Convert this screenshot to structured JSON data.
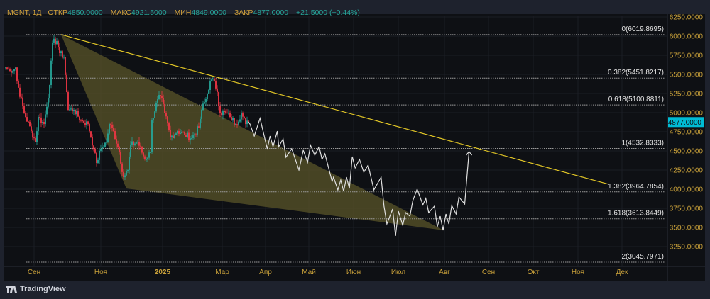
{
  "legend": {
    "symbol": "MGNT, 1Д",
    "open_label": "ОТКР",
    "open": "4850.0000",
    "high_label": "МАКС",
    "high": "4921.5000",
    "low_label": "МИН",
    "low": "4849.0000",
    "close_label": "ЗАКР",
    "close": "4877.0000",
    "change": "+21.5000 (+0.44%)"
  },
  "branding": {
    "name": "TradingView"
  },
  "colors": {
    "up": "#26a69a",
    "down": "#f23645",
    "trend": "#e3c726",
    "fill": "#5a5428",
    "projection": "#e0e0e0",
    "axis_text": "#c9a13a",
    "price_badge": "#00bcd4"
  },
  "chart_data": {
    "type": "candlestick",
    "symbol": "MGNT",
    "interval": "1D",
    "ylim": [
      3050,
      6300
    ],
    "y_ticks": [
      "6250.0000",
      "6000.0000",
      "5750.0000",
      "5500.0000",
      "5250.0000",
      "5000.0000",
      "4750.0000",
      "4500.0000",
      "4250.0000",
      "4000.0000",
      "3750.0000",
      "3500.0000",
      "3250.0000"
    ],
    "y_tick_values": [
      6250,
      6000,
      5750,
      5500,
      5250,
      5000,
      4750,
      4500,
      4250,
      4000,
      3750,
      3500,
      3250
    ],
    "x_ticks": [
      "Сен",
      "Ноя",
      "2025",
      "Мар",
      "Апр",
      "Май",
      "Июн",
      "Июл",
      "Авг",
      "Сен",
      "Окт",
      "Ноя",
      "Дек"
    ],
    "last_price": "4877.0000",
    "last_price_value": 4877,
    "close_waypoints": [
      [
        0,
        5590
      ],
      [
        3,
        5546
      ],
      [
        7,
        5590
      ],
      [
        8,
        5407
      ],
      [
        13,
        5000
      ],
      [
        18,
        4759
      ],
      [
        21,
        4620
      ],
      [
        23,
        4944
      ],
      [
        27,
        4851
      ],
      [
        31,
        5361
      ],
      [
        33,
        5917
      ],
      [
        36,
        5935
      ],
      [
        38,
        5778
      ],
      [
        41,
        5731
      ],
      [
        43,
        5268
      ],
      [
        44,
        5037
      ],
      [
        48,
        5037
      ],
      [
        53,
        4898
      ],
      [
        58,
        4851
      ],
      [
        62,
        4528
      ],
      [
        64,
        4343
      ],
      [
        67,
        4528
      ],
      [
        71,
        4620
      ],
      [
        73,
        4851
      ],
      [
        76,
        4759
      ],
      [
        80,
        4481
      ],
      [
        83,
        4157
      ],
      [
        86,
        4250
      ],
      [
        88,
        4574
      ],
      [
        93,
        4620
      ],
      [
        98,
        4389
      ],
      [
        102,
        4481
      ],
      [
        103,
        4898
      ],
      [
        107,
        5176
      ],
      [
        109,
        5222
      ],
      [
        112,
        5000
      ],
      [
        116,
        4676
      ],
      [
        121,
        4759
      ],
      [
        126,
        4713
      ],
      [
        131,
        4667
      ],
      [
        136,
        4806
      ],
      [
        138,
        5037
      ],
      [
        141,
        5176
      ],
      [
        144,
        5407
      ],
      [
        147,
        5407
      ],
      [
        149,
        5268
      ],
      [
        151,
        5000
      ],
      [
        155,
        5000
      ],
      [
        158,
        4944
      ],
      [
        162,
        4851
      ],
      [
        166,
        4990
      ],
      [
        169,
        4851
      ],
      [
        171,
        4877
      ]
    ],
    "fib_levels": [
      {
        "label": "0(6019.8695)",
        "value": 6019.8695
      },
      {
        "label": "0.382(5451.8217)",
        "value": 5451.8217
      },
      {
        "label": "0.618(5100.8811)",
        "value": 5100.8811
      },
      {
        "label": "1(4532.8333)",
        "value": 4532.8333
      },
      {
        "label": "1.382(3964.7854)",
        "value": 3964.7854
      },
      {
        "label": "1.618(3613.8449)",
        "value": 3613.8449
      },
      {
        "label": "2(3045.7971)",
        "value": 3045.7971
      }
    ],
    "trendline_prices": [
      6019.87,
      4065
    ],
    "triangle_prices": [
      6019.87,
      4009,
      3463
    ],
    "projection_days_after_last": [
      [
        0,
        4877
      ],
      [
        1,
        4852
      ],
      [
        4,
        4694
      ],
      [
        8,
        4926
      ],
      [
        13,
        4528
      ],
      [
        15,
        4694
      ],
      [
        17,
        4556
      ],
      [
        20,
        4759
      ],
      [
        21,
        4556
      ],
      [
        24,
        4657
      ],
      [
        26,
        4417
      ],
      [
        30,
        4528
      ],
      [
        35,
        4250
      ],
      [
        38,
        4509
      ],
      [
        41,
        4352
      ],
      [
        43,
        4574
      ],
      [
        46,
        4444
      ],
      [
        49,
        4556
      ],
      [
        51,
        4389
      ],
      [
        53,
        4463
      ],
      [
        58,
        4102
      ],
      [
        59,
        4157
      ],
      [
        62,
        3991
      ],
      [
        64,
        4120
      ],
      [
        66,
        3972
      ],
      [
        68,
        4157
      ],
      [
        70,
        4009
      ],
      [
        72,
        4426
      ],
      [
        74,
        4278
      ],
      [
        77,
        4389
      ],
      [
        80,
        4222
      ],
      [
        83,
        4315
      ],
      [
        87,
        3991
      ],
      [
        92,
        4157
      ],
      [
        94,
        3778
      ],
      [
        96,
        3546
      ],
      [
        100,
        3741
      ],
      [
        102,
        3389
      ],
      [
        104,
        3713
      ],
      [
        107,
        3528
      ],
      [
        109,
        3694
      ],
      [
        112,
        3648
      ],
      [
        114,
        3852
      ],
      [
        117,
        4000
      ],
      [
        121,
        3796
      ],
      [
        123,
        3880
      ],
      [
        125,
        3694
      ],
      [
        129,
        3778
      ],
      [
        131,
        3509
      ],
      [
        133,
        3648
      ],
      [
        135,
        3463
      ],
      [
        137,
        3676
      ],
      [
        139,
        3546
      ],
      [
        141,
        3787
      ],
      [
        144,
        3676
      ],
      [
        146,
        3898
      ],
      [
        150,
        3806
      ],
      [
        153,
        4491
      ]
    ]
  }
}
